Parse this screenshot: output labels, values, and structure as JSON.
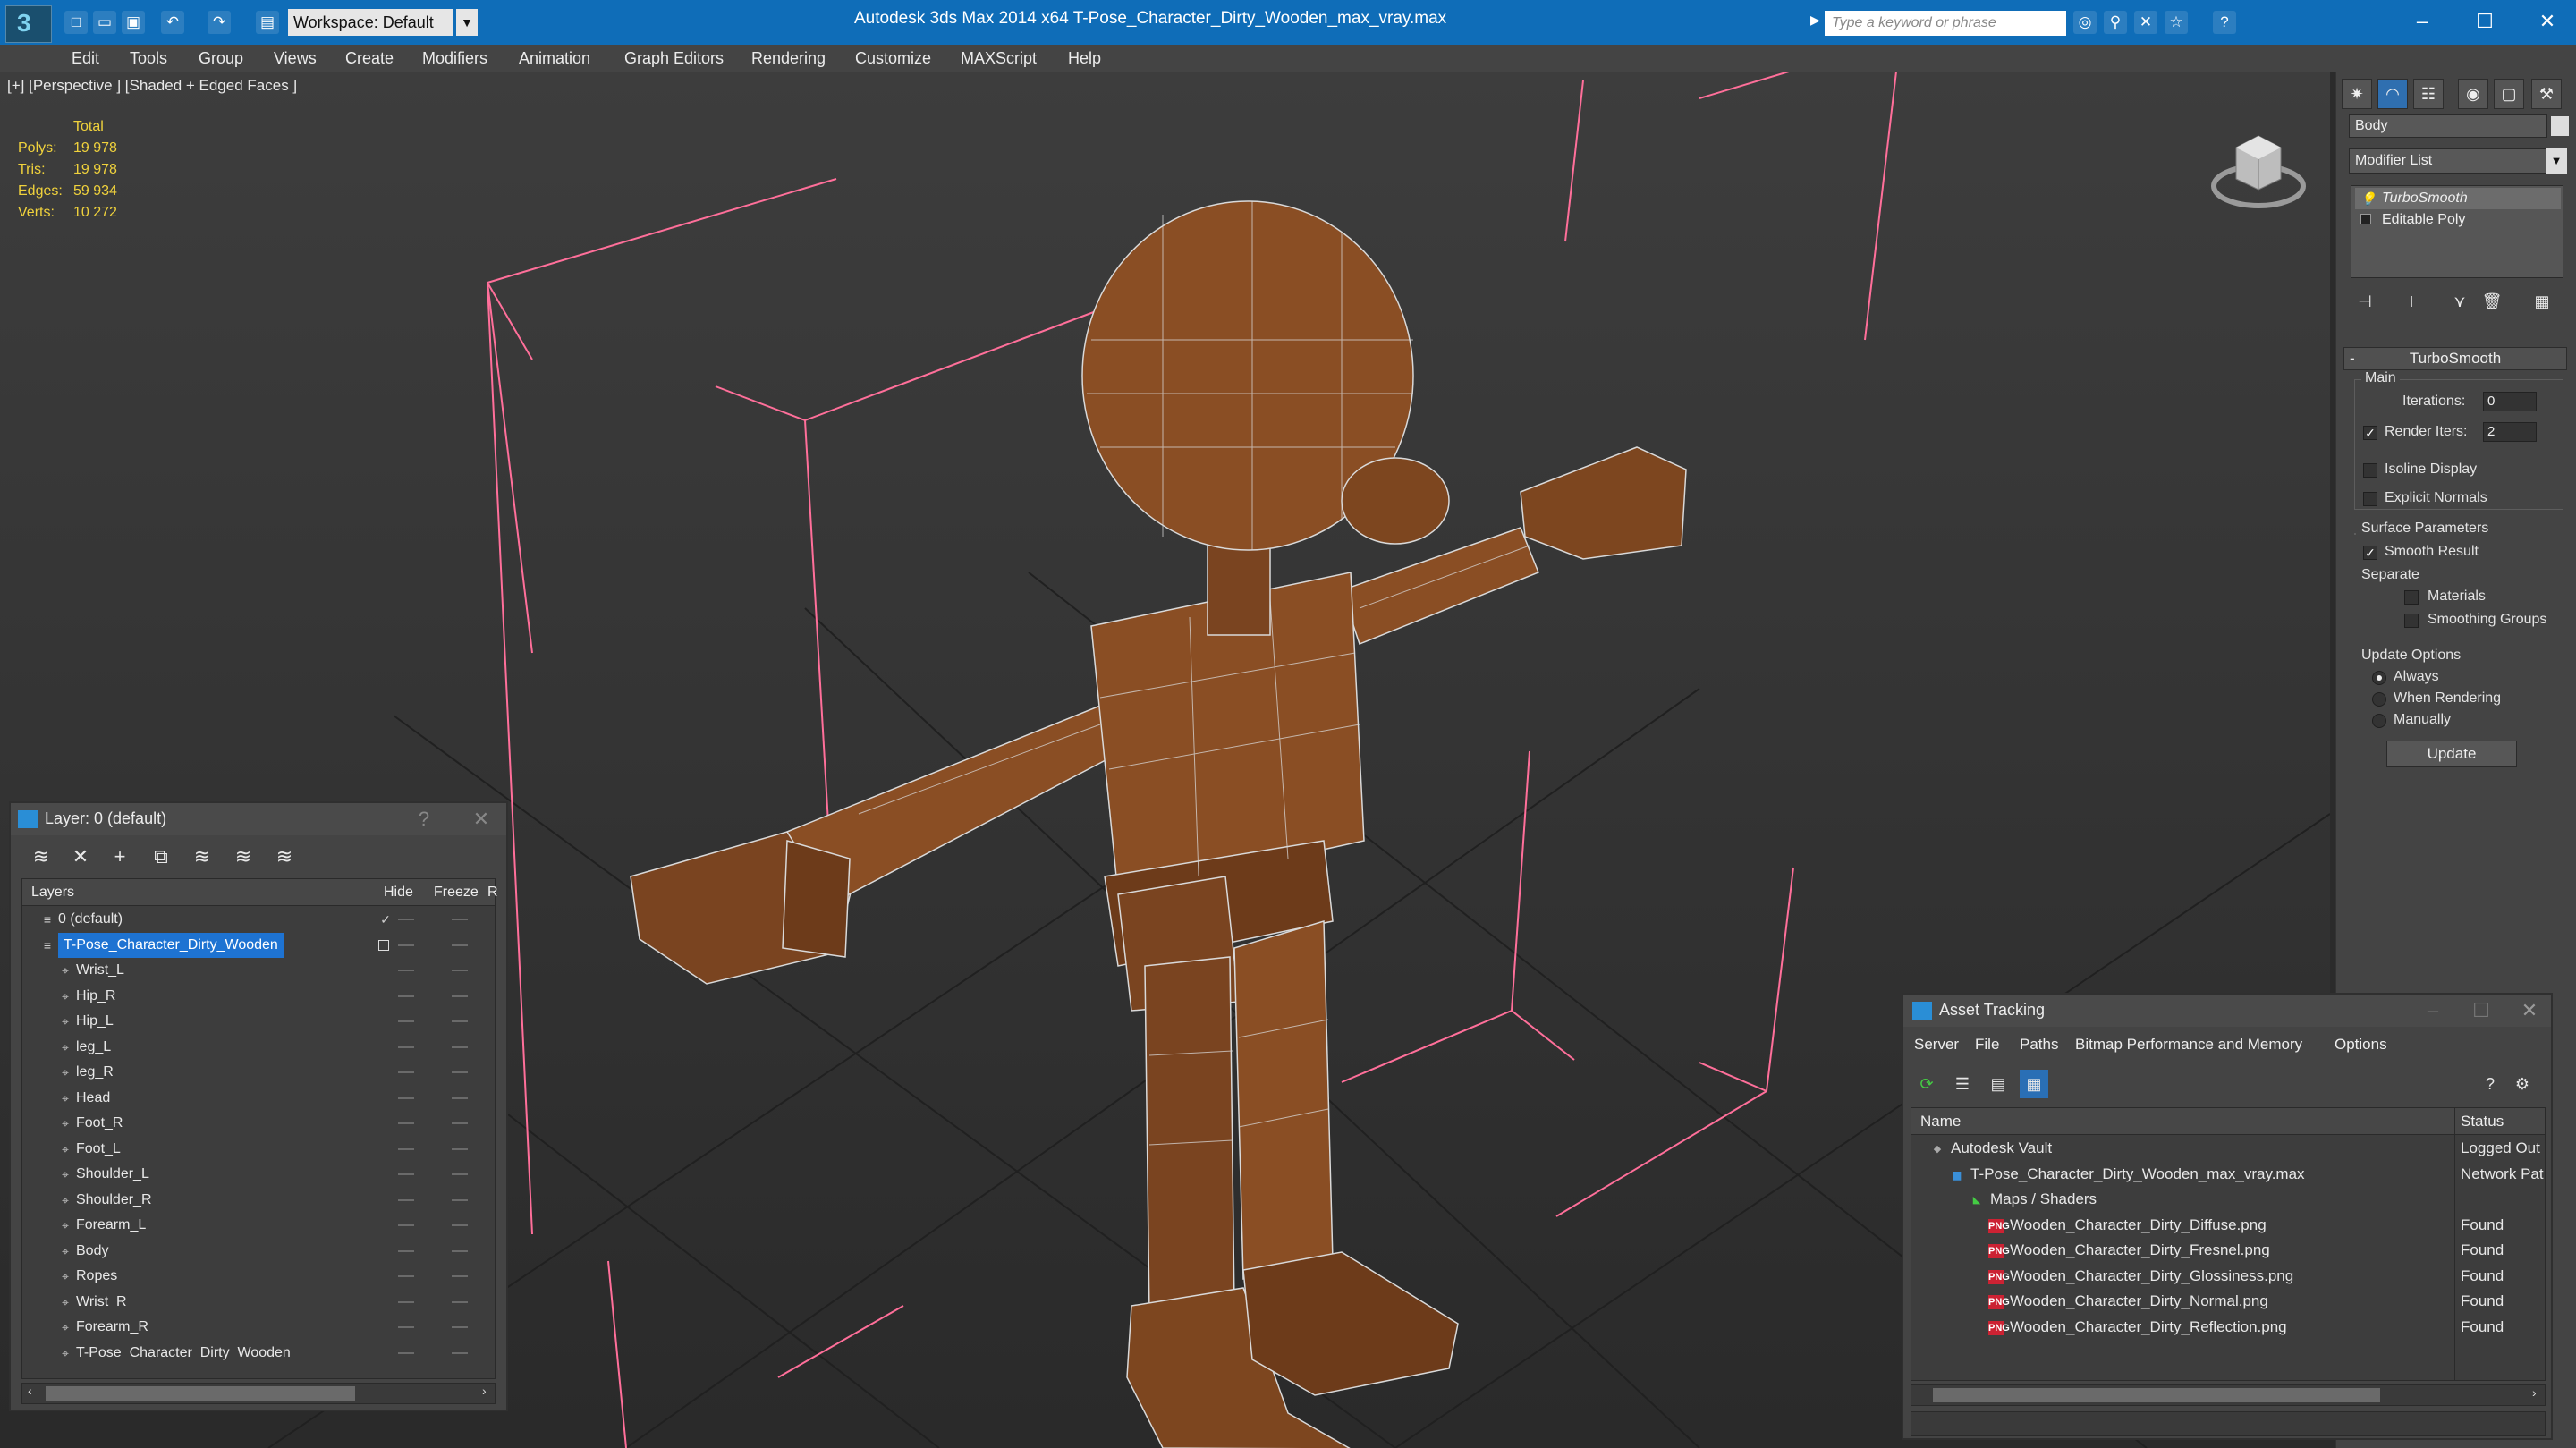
{
  "window": {
    "title": "Autodesk 3ds Max  2014 x64      T-Pose_Character_Dirty_Wooden_max_vray.max",
    "workspace": "Workspace: Default",
    "search_placeholder": "Type a keyword or phrase"
  },
  "menubar": [
    "Edit",
    "Tools",
    "Group",
    "Views",
    "Create",
    "Modifiers",
    "Animation",
    "Graph Editors",
    "Rendering",
    "Customize",
    "MAXScript",
    "Help"
  ],
  "viewport": {
    "label": "[+] [Perspective ] [Shaded + Edged Faces ]",
    "stats": {
      "header": "Total",
      "rows": [
        {
          "key": "Polys:",
          "value": "19 978"
        },
        {
          "key": "Tris:",
          "value": "19 978"
        },
        {
          "key": "Edges:",
          "value": "59 934"
        },
        {
          "key": "Verts:",
          "value": "10 272"
        }
      ]
    }
  },
  "command_panel": {
    "object_name": "Body",
    "modifier_list": "Modifier List",
    "stack": [
      "TurboSmooth",
      "Editable Poly"
    ],
    "rollout_title": "TurboSmooth",
    "main_group": "Main",
    "iterations_label": "Iterations:",
    "iterations_value": "0",
    "render_iters_label": "Render Iters:",
    "render_iters_value": "2",
    "isoline_display": "Isoline Display",
    "explicit_normals": "Explicit Normals",
    "surface_params": "Surface Parameters",
    "smooth_result": "Smooth Result",
    "separate": "Separate",
    "materials": "Materials",
    "smoothing_groups": "Smoothing Groups",
    "update_options": "Update Options",
    "always": "Always",
    "when_rendering": "When Rendering",
    "manually": "Manually",
    "update_button": "Update"
  },
  "layer_explorer": {
    "title": "Layer: 0 (default)",
    "columns": {
      "layers": "Layers",
      "hide": "Hide",
      "freeze": "Freeze",
      "render": "R"
    },
    "rows": [
      {
        "name": "0 (default)",
        "level": 1,
        "type": "layer",
        "checked": true
      },
      {
        "name": "T-Pose_Character_Dirty_Wooden",
        "level": 1,
        "type": "layer",
        "selected": true
      },
      {
        "name": "Wrist_L",
        "level": 2,
        "type": "object"
      },
      {
        "name": "Hip_R",
        "level": 2,
        "type": "object"
      },
      {
        "name": "Hip_L",
        "level": 2,
        "type": "object"
      },
      {
        "name": "leg_L",
        "level": 2,
        "type": "object"
      },
      {
        "name": "leg_R",
        "level": 2,
        "type": "object"
      },
      {
        "name": "Head",
        "level": 2,
        "type": "object"
      },
      {
        "name": "Foot_R",
        "level": 2,
        "type": "object"
      },
      {
        "name": "Foot_L",
        "level": 2,
        "type": "object"
      },
      {
        "name": "Shoulder_L",
        "level": 2,
        "type": "object"
      },
      {
        "name": "Shoulder_R",
        "level": 2,
        "type": "object"
      },
      {
        "name": "Forearm_L",
        "level": 2,
        "type": "object"
      },
      {
        "name": "Body",
        "level": 2,
        "type": "object"
      },
      {
        "name": "Ropes",
        "level": 2,
        "type": "object"
      },
      {
        "name": "Wrist_R",
        "level": 2,
        "type": "object"
      },
      {
        "name": "Forearm_R",
        "level": 2,
        "type": "object"
      },
      {
        "name": "T-Pose_Character_Dirty_Wooden",
        "level": 2,
        "type": "object"
      }
    ]
  },
  "asset_tracking": {
    "title": "Asset Tracking",
    "menu": [
      "Server",
      "File",
      "Paths",
      "Bitmap Performance and Memory",
      "Options"
    ],
    "columns": {
      "name": "Name",
      "status": "Status"
    },
    "rows": [
      {
        "name": "Autodesk Vault",
        "status": "Logged Out",
        "level": 1,
        "icon": "vault"
      },
      {
        "name": "T-Pose_Character_Dirty_Wooden_max_vray.max",
        "status": "Network Pat",
        "level": 2,
        "icon": "max"
      },
      {
        "name": "Maps / Shaders",
        "status": "",
        "level": 3,
        "icon": "maps"
      },
      {
        "name": "Wooden_Character_Dirty_Diffuse.png",
        "status": "Found",
        "level": 4,
        "icon": "png"
      },
      {
        "name": "Wooden_Character_Dirty_Fresnel.png",
        "status": "Found",
        "level": 4,
        "icon": "png"
      },
      {
        "name": "Wooden_Character_Dirty_Glossiness.png",
        "status": "Found",
        "level": 4,
        "icon": "png"
      },
      {
        "name": "Wooden_Character_Dirty_Normal.png",
        "status": "Found",
        "level": 4,
        "icon": "png"
      },
      {
        "name": "Wooden_Character_Dirty_Reflection.png",
        "status": "Found",
        "level": 4,
        "icon": "png"
      }
    ]
  },
  "colors": {
    "titlebar": "#0f6db8",
    "selection": "#1e73d2",
    "stats": "#f0d23c",
    "wood": "#8a4e24"
  }
}
